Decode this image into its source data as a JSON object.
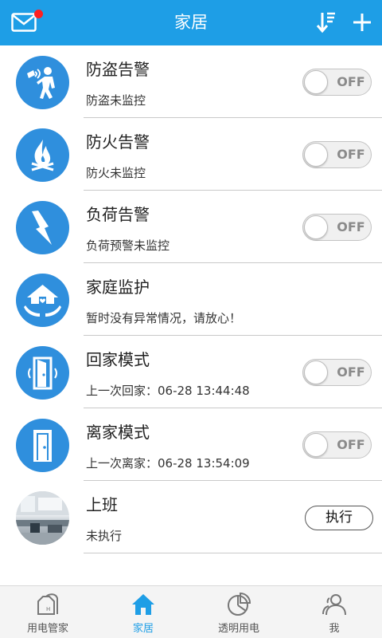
{
  "header": {
    "title": "家居",
    "mail_icon": "mail-icon",
    "sort_icon": "sort-down-icon",
    "add_icon": "plus-icon"
  },
  "items": [
    {
      "name": "防盗告警",
      "status": "防盗未监控",
      "icon": "burglar-icon",
      "control": "toggle",
      "toggle_label": "OFF"
    },
    {
      "name": "防火告警",
      "status": "防火未监控",
      "icon": "fire-icon",
      "control": "toggle",
      "toggle_label": "OFF"
    },
    {
      "name": "负荷告警",
      "status": "负荷预警未监控",
      "icon": "lightning-icon",
      "control": "toggle",
      "toggle_label": "OFF"
    },
    {
      "name": "家庭监护",
      "status": "暂时没有异常情况，请放心！",
      "icon": "home-care-icon",
      "control": "none"
    },
    {
      "name": "回家模式",
      "status": "上一次回家：06-28 13:44:48",
      "icon": "door-return-icon",
      "control": "toggle",
      "toggle_label": "OFF"
    },
    {
      "name": "离家模式",
      "status": "上一次离家：06-28 13:54:09",
      "icon": "door-leave-icon",
      "control": "toggle",
      "toggle_label": "OFF"
    },
    {
      "name": "上班",
      "status": "未执行",
      "icon": "office-photo",
      "control": "button",
      "button_label": "执行"
    }
  ],
  "tabs": [
    {
      "label": "用电管家",
      "icon": "house-meter-icon",
      "active": false
    },
    {
      "label": "家居",
      "icon": "home-icon",
      "active": true
    },
    {
      "label": "透明用电",
      "icon": "pie-chart-icon",
      "active": false
    },
    {
      "label": "我",
      "icon": "user-icon",
      "active": false
    }
  ],
  "colors": {
    "primary": "#1e9ee6",
    "icon_circle": "#2f8fdd",
    "alert_dot": "#ff2020"
  }
}
